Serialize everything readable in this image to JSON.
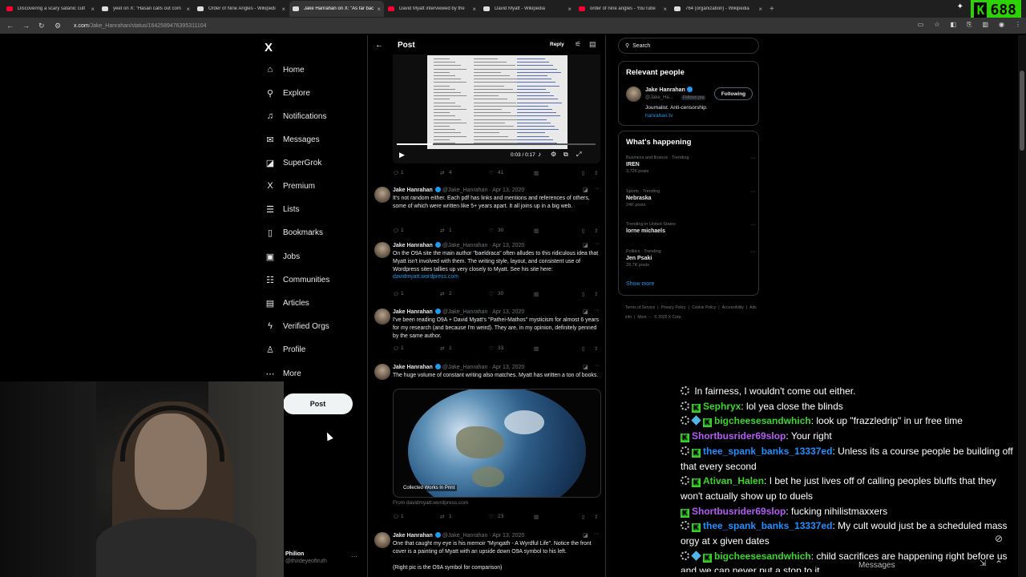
{
  "browser": {
    "tabs": [
      {
        "title": "Discovering a scary satanic cult",
        "favicon": "youtube",
        "color": "#ff0033"
      },
      {
        "title": "yeet on X: \"Hasan calls out com",
        "favicon": "x",
        "color": "#dddddd"
      },
      {
        "title": "Order of Nine Angles - Wikipedi",
        "favicon": "wikipedia",
        "color": "#dddddd"
      },
      {
        "title": "Jake Hanrahan on X: \"As far bac",
        "favicon": "x",
        "color": "#dddddd"
      },
      {
        "title": "David Myatt interviewed by the",
        "favicon": "youtube",
        "color": "#ff0033"
      },
      {
        "title": "David Myatt - Wikipedia",
        "favicon": "wikipedia",
        "color": "#dddddd"
      },
      {
        "title": "order of nine angles - YouTube",
        "favicon": "youtube",
        "color": "#ff0033"
      },
      {
        "title": "764 (organization) - Wikipedia",
        "favicon": "wikipedia",
        "color": "#dddddd"
      }
    ],
    "active_tab": 3,
    "url_domain": "x.com",
    "url_path": "/Jake_Hanrahan/status/1642589476395311104",
    "counter": "688",
    "counter_logo": "K"
  },
  "sidebar": {
    "logo": "X",
    "items": [
      {
        "label": "Home",
        "icon": "home-icon",
        "glyph": "⌂"
      },
      {
        "label": "Explore",
        "icon": "search-icon",
        "glyph": "⚲"
      },
      {
        "label": "Notifications",
        "icon": "bell-icon",
        "glyph": "♫"
      },
      {
        "label": "Messages",
        "icon": "mail-icon",
        "glyph": "✉"
      },
      {
        "label": "SuperGrok",
        "icon": "grok-icon",
        "glyph": "◪"
      },
      {
        "label": "Premium",
        "icon": "x-icon",
        "glyph": "X"
      },
      {
        "label": "Lists",
        "icon": "list-icon",
        "glyph": "☰"
      },
      {
        "label": "Bookmarks",
        "icon": "bookmark-icon",
        "glyph": "▯"
      },
      {
        "label": "Jobs",
        "icon": "briefcase-icon",
        "glyph": "▣"
      },
      {
        "label": "Communities",
        "icon": "people-icon",
        "glyph": "☷"
      },
      {
        "label": "Articles",
        "icon": "article-icon",
        "glyph": "▤"
      },
      {
        "label": "Verified Orgs",
        "icon": "lightning-icon",
        "glyph": "ϟ"
      },
      {
        "label": "Profile",
        "icon": "person-icon",
        "glyph": "♙"
      },
      {
        "label": "More",
        "icon": "more-circle-icon",
        "glyph": "⋯"
      }
    ],
    "post_label": "Post",
    "account": {
      "name": "Philion",
      "handle": "@thirdeyeoftruth"
    }
  },
  "header": {
    "title": "Post",
    "reply_label": "Reply"
  },
  "video": {
    "time": "0:03 / 0:17",
    "progress": 0.18
  },
  "first_actions": {
    "replies": "1",
    "reposts": "4",
    "likes": "41"
  },
  "tweets": [
    {
      "name": "Jake Hanrahan",
      "handle": "@Jake_Hanrahan · Apr 13, 2020",
      "text": "It's not random either. Each pdf has links and mentions and references of others, some of which were written like 5+ years apart. It all joins up in a big web.",
      "link": "",
      "replies": "1",
      "reposts": "1",
      "likes": "30"
    },
    {
      "name": "Jake Hanrahan",
      "handle": "@Jake_Hanrahan · Apr 13, 2020",
      "text": "On the O9A site the main author \"baeldraca\" often alludes to this ridiculous idea that Myatt isn't involved with them. The writing style, layout, and consistent use of Wordpress sites tallies up very closely to Myatt. See his site here:",
      "link": "davidmyatt.wordpress.com",
      "replies": "1",
      "reposts": "2",
      "likes": "30"
    },
    {
      "name": "Jake Hanrahan",
      "handle": "@Jake_Hanrahan · Apr 13, 2020",
      "text": "I've been reading O9A + David Myatt's \"Pathei-Mathos\" mysticism for almost 6 years for my research (and because I'm weird). They are, in my opinion, definitely penned by the same author.",
      "link": "",
      "replies": "1",
      "reposts": "1",
      "likes": "33"
    },
    {
      "name": "Jake Hanrahan",
      "handle": "@Jake_Hanrahan · Apr 13, 2020",
      "text": "The huge volume of constant writing also matches. Myatt has written a ton of books.",
      "link": "",
      "replies": "1",
      "reposts": "1",
      "likes": "23"
    },
    {
      "name": "Jake Hanrahan",
      "handle": "@Jake_Hanrahan · Apr 13, 2020",
      "text": "One that caught my eye is his memoir \"Myngath - A Wyrdful Life\". Notice the front cover is a painting of Myatt with an upside down O9A symbol to his left.",
      "link": "",
      "extra": "(Right pic is the O9A symbol for comparison)"
    }
  ],
  "media": {
    "caption": "Collected Works In Print",
    "from": "From davidmyatt.wordpress.com"
  },
  "right": {
    "search_placeholder": "Search",
    "relevant_title": "Relevant people",
    "person": {
      "name": "Jake Hanrahan",
      "handle": "@Jake_Ha...",
      "follows": "Follows you",
      "button": "Following",
      "bio": "Journalist. Anti-censorship.",
      "link": "hanrahan.tv"
    },
    "happening_title": "What's happening",
    "trends": [
      {
        "category": "Business and finance · Trending",
        "title": "IREN",
        "count": "3,726 posts"
      },
      {
        "category": "Sports · Trending",
        "title": "Nebraska",
        "count": "24K posts"
      },
      {
        "category": "Trending in United States",
        "title": "lorne michaels",
        "count": ""
      },
      {
        "category": "Politics · Trending",
        "title": "Jen Psaki",
        "count": "28.7K posts"
      }
    ],
    "show_more": "Show more",
    "footer": [
      "Terms of Service",
      "|",
      "Privacy Policy",
      "|",
      "Cookie Policy",
      "|",
      "Accessibility",
      "|",
      "Ads info",
      "|",
      "More ···",
      "© 2025 X Corp."
    ]
  },
  "chat": {
    "messages": [
      {
        "badges": [
          "gear"
        ],
        "user": "",
        "color": "#39d62a",
        "text": "In fairness, I wouldn't come out either."
      },
      {
        "badges": [
          "gear",
          "k"
        ],
        "user": "Sephryx",
        "color": "#39d62a",
        "text": "lol yea close the blinds"
      },
      {
        "badges": [
          "gear",
          "cube",
          "k"
        ],
        "user": "bigcheesesandwhich",
        "color": "#39d62a",
        "text": "look up \"frazzledrip\" in ur free time"
      },
      {
        "badges": [
          "k"
        ],
        "user": "Shortbusrider69slop",
        "color": "#b45cf6",
        "text": "Your right"
      },
      {
        "badges": [
          "gear",
          "k"
        ],
        "user": "thee_spank_banks_13337ed",
        "color": "#1e90ff",
        "text": "Unless its a course people be building off that every second"
      },
      {
        "badges": [
          "gear",
          "k"
        ],
        "user": "Ativan_Halen",
        "color": "#39d62a",
        "text": "I bet he just lives off of calling peoples bluffs that they won't actually show up to duels"
      },
      {
        "badges": [
          "k"
        ],
        "user": "Shortbusrider69slop",
        "color": "#b45cf6",
        "text": "fucking nihilistmaxxers"
      },
      {
        "badges": [
          "gear",
          "k"
        ],
        "user": "thee_spank_banks_13337ed",
        "color": "#1e90ff",
        "text": "My cult would just be a scheduled mass orgy at x given dates"
      },
      {
        "badges": [
          "gear",
          "cube",
          "k"
        ],
        "user": "bigcheesesandwhich",
        "color": "#39d62a",
        "text": "child sacrifices are happening right before us and we can never put a stop to it"
      }
    ],
    "label": "Messages"
  }
}
